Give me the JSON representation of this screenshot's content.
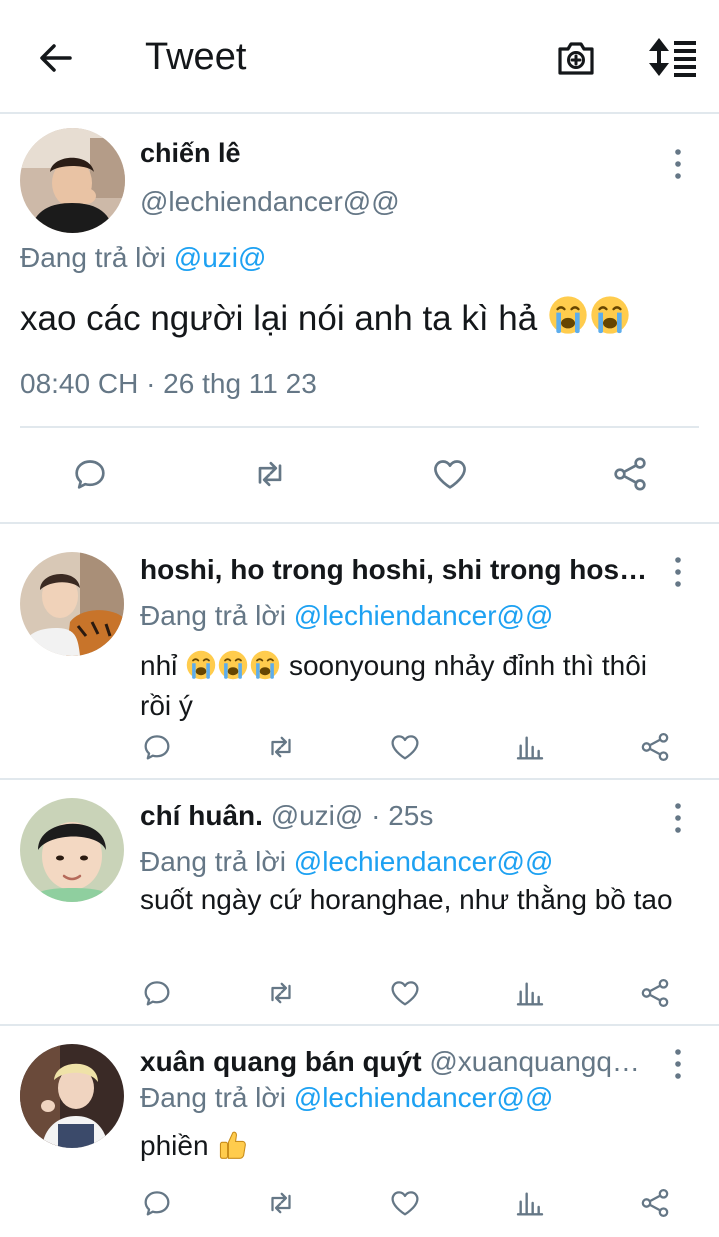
{
  "header": {
    "title": "Tweet",
    "back_icon": "arrow-left-icon",
    "camera_icon": "camera-plus-icon",
    "sort_icon": "sort-icon"
  },
  "main_tweet": {
    "name": "chiến lê",
    "handle": "@lechiendancer@@",
    "reply_prefix": "Đang trả lời",
    "reply_to": "@uzi@",
    "text": "xao các người lại nói anh ta kì hả",
    "emojis": [
      "crying-face",
      "crying-face"
    ],
    "timestamp": "08:40 CH · 26 thg 11 23"
  },
  "replies": [
    {
      "name": "hoshi, ho trong hoshi, shi trong hos…",
      "handle": "",
      "time": "",
      "reply_prefix": "Đang trả lời",
      "reply_to": "@lechiendancer@@",
      "text_before": "nhỉ",
      "emojis": [
        "crying-face",
        "crying-face",
        "crying-face"
      ],
      "text_after": "soonyoung nhảy đỉnh thì thôi rồi ý"
    },
    {
      "name": "chí huân.",
      "handle": "@uzi@ · 25s",
      "reply_prefix": "Đang trả lời",
      "reply_to": "@lechiendancer@@",
      "text": "suốt ngày cứ horanghae, như thằng bồ tao"
    },
    {
      "name": "xuân quang bán quýt",
      "handle": "@xuanquangq…",
      "reply_prefix": "Đang trả lời",
      "reply_to": "@lechiendancer@@",
      "text": "phiền",
      "emojis": [
        "thumbs-up"
      ]
    }
  ],
  "colors": {
    "link": "#1da1f2",
    "secondary_text": "#657786",
    "divider": "#e1e8ed",
    "icon": "#657786"
  }
}
